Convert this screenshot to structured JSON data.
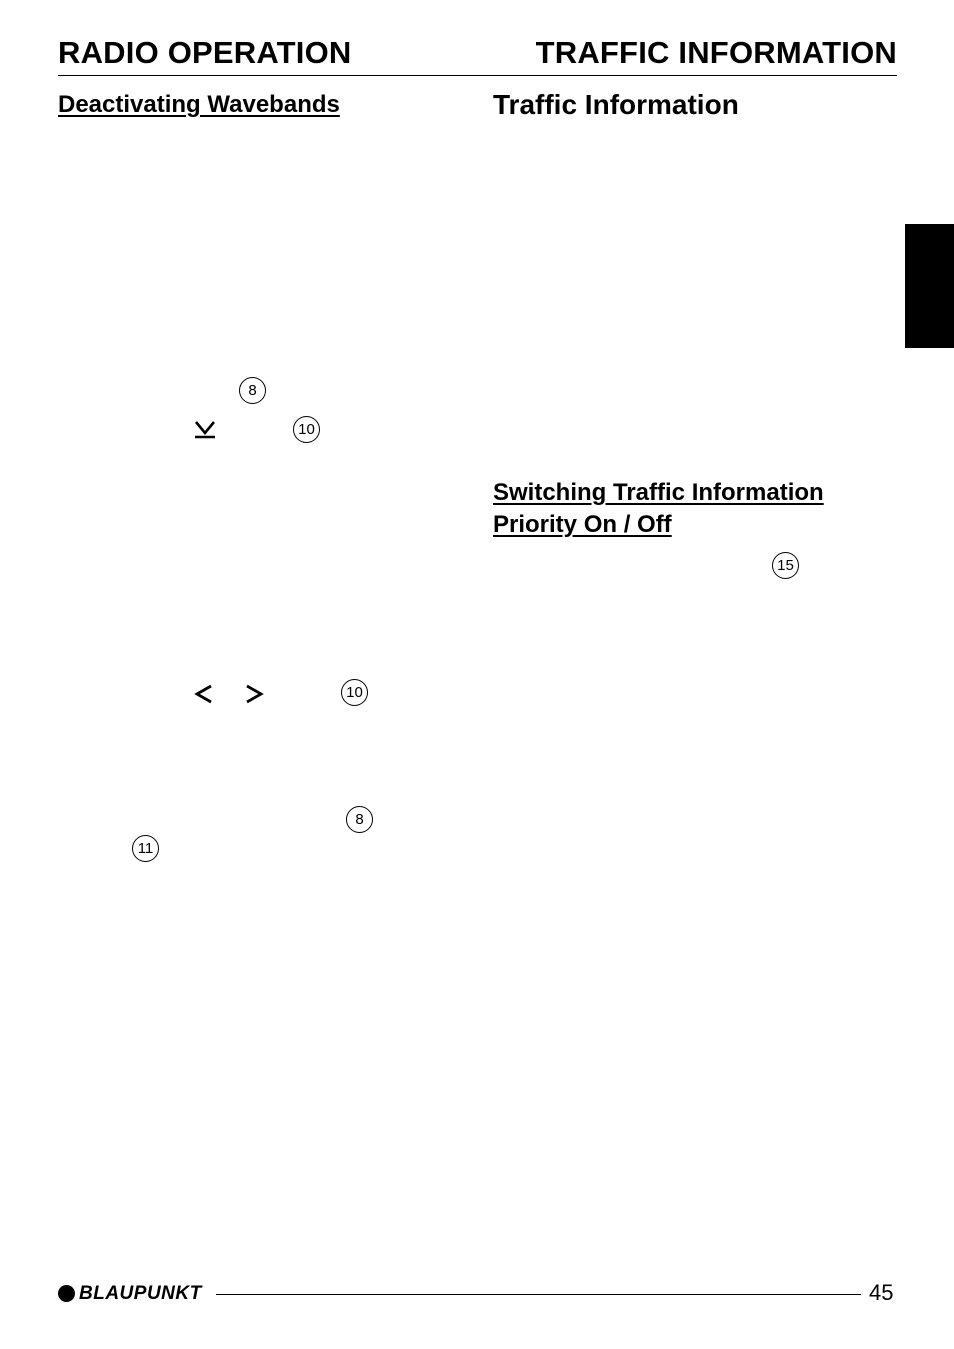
{
  "header": {
    "left_title": "RADIO OPERATION",
    "right_title": "TRAFFIC INFORMATION"
  },
  "left_column": {
    "heading": "Deactivating Wavebands",
    "callouts": [
      "8",
      "10",
      "10",
      "8",
      "11"
    ],
    "icons": [
      "down-arrow-underlined-icon",
      "left-arrow-icon",
      "right-arrow-icon"
    ],
    "glyphs": {
      "left": "<",
      "right": ">"
    }
  },
  "right_column": {
    "heading": "Traffic Information",
    "subheading_line1": "Switching Traffic Information",
    "subheading_line2": "Priority On / Off",
    "callouts": [
      "15"
    ]
  },
  "side_tab": {
    "color": "#000000"
  },
  "footer": {
    "brand": "BLAUPUNKT",
    "page_number": "45"
  }
}
